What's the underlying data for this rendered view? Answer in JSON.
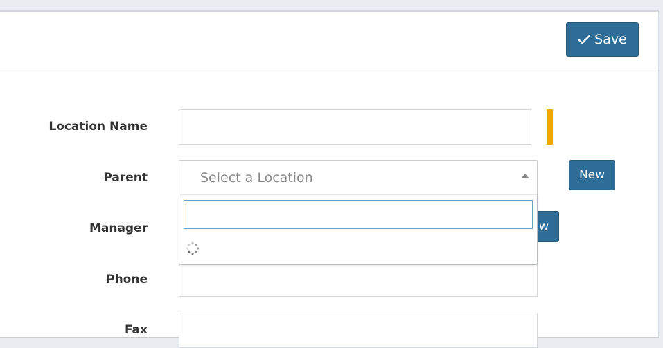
{
  "header": {
    "save_label": "Save"
  },
  "form": {
    "location_name": {
      "label": "Location Name",
      "value": ""
    },
    "parent": {
      "label": "Parent",
      "placeholder": "Select a Location",
      "new_label": "New"
    },
    "parent_dropdown": {
      "search_value": "",
      "state": "loading"
    },
    "manager": {
      "label": "Manager",
      "new_label_partial": "w"
    },
    "phone": {
      "label": "Phone",
      "value": ""
    },
    "fax": {
      "label": "Fax",
      "value": ""
    }
  },
  "colors": {
    "primary": "#2e6d97",
    "required_indicator": "#f0a800",
    "focus_border": "#6aa0c4"
  },
  "icons": {
    "save": "check-icon",
    "select_toggle": "caret-up-icon",
    "loading": "spinner-icon"
  }
}
